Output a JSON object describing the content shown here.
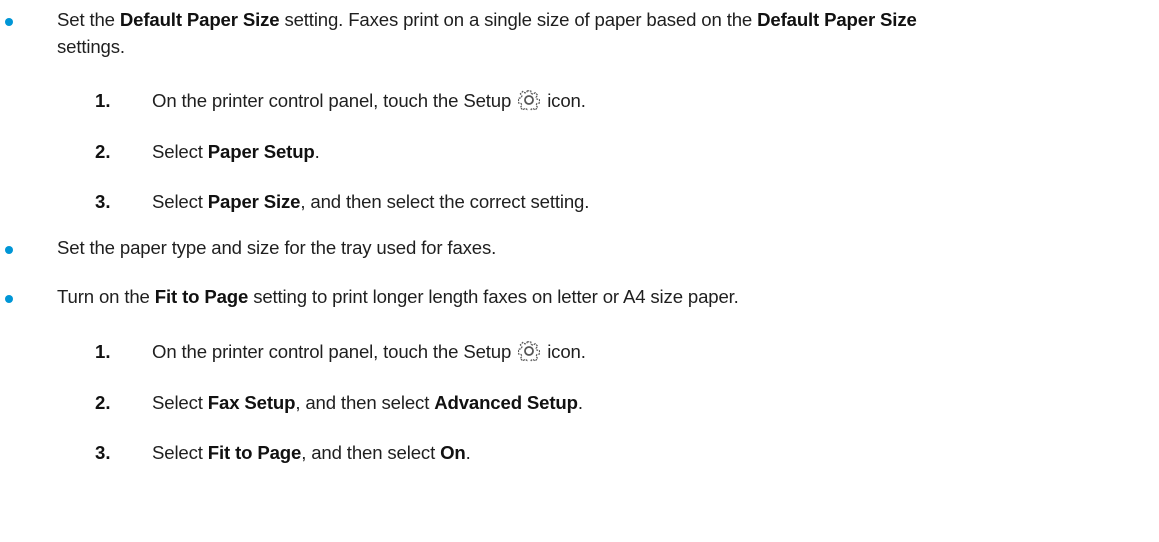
{
  "bullet1": {
    "p1": "Set the ",
    "b1": "Default Paper Size",
    "p2": " setting. Faxes print on a single size of paper based on the ",
    "b2": "Default Paper Size",
    "p3": "settings."
  },
  "steps1": [
    {
      "num": "1.",
      "pre": "On the printer control panel, touch the Setup ",
      "icon": "gear-icon",
      "post": " icon."
    },
    {
      "num": "2.",
      "pre": "Select ",
      "bold": "Paper Setup",
      "post": "."
    },
    {
      "num": "3.",
      "pre": "Select ",
      "bold": "Paper Size",
      "post": ", and then select the correct setting."
    }
  ],
  "bullet2": {
    "text": "Set the paper type and size for the tray used for faxes."
  },
  "bullet3": {
    "p1": "Turn on the ",
    "b1": "Fit to Page",
    "p2": " setting to print longer length faxes on letter or A4 size paper."
  },
  "steps3": [
    {
      "num": "1.",
      "pre": "On the printer control panel, touch the Setup ",
      "icon": "gear-icon",
      "post": " icon."
    },
    {
      "num": "2.",
      "pre": "Select ",
      "bold": "Fax Setup",
      "mid": ", and then select ",
      "bold2": "Advanced Setup",
      "post": "."
    },
    {
      "num": "3.",
      "pre": "Select ",
      "bold": "Fit to Page",
      "mid": ", and then select ",
      "bold2": "On",
      "post": "."
    }
  ],
  "colors": {
    "bullet": "#0096d6",
    "text": "#1f1f1f"
  }
}
